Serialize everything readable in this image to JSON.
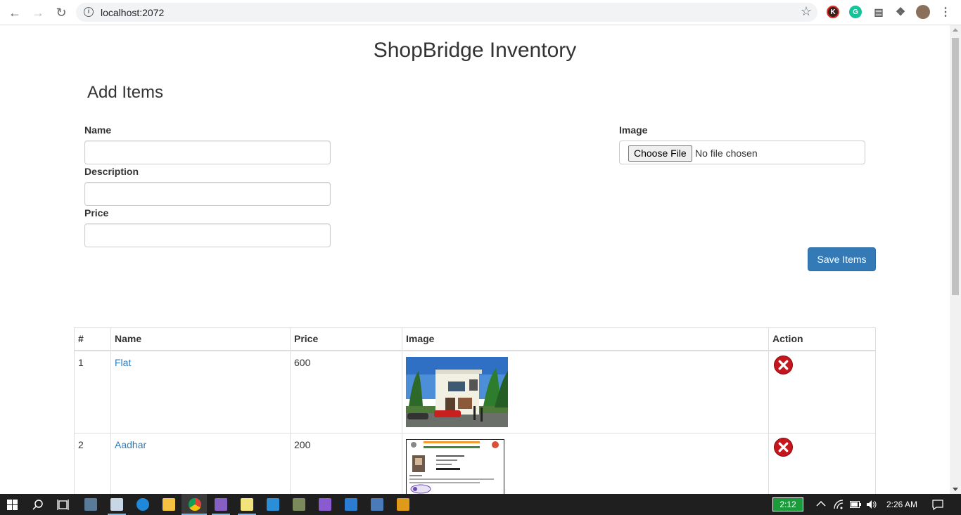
{
  "browser": {
    "url": "localhost:2072",
    "extensions": [
      "K",
      "G"
    ]
  },
  "page": {
    "title": "ShopBridge Inventory",
    "subtitle": "Add Items",
    "form": {
      "name_label": "Name",
      "name_value": "",
      "description_label": "Description",
      "description_value": "",
      "price_label": "Price",
      "price_value": "",
      "image_label": "Image",
      "file_button": "Choose File",
      "file_status": "No file chosen",
      "save_label": "Save Items"
    },
    "table": {
      "headers": [
        "#",
        "Name",
        "Price",
        "Image",
        "Action"
      ],
      "rows": [
        {
          "num": "1",
          "name": "Flat",
          "price": "600",
          "image": "house-photo",
          "action": "delete-icon"
        },
        {
          "num": "2",
          "name": "Aadhar",
          "price": "200",
          "image": "id-card-photo",
          "action": "delete-icon"
        }
      ]
    }
  },
  "taskbar": {
    "battery_time": "2:12",
    "clock": "2:26 AM"
  },
  "colors": {
    "primary": "#337ab7",
    "link": "#337ab7",
    "delete": "#c4161c",
    "battery": "#1a9c3a"
  }
}
